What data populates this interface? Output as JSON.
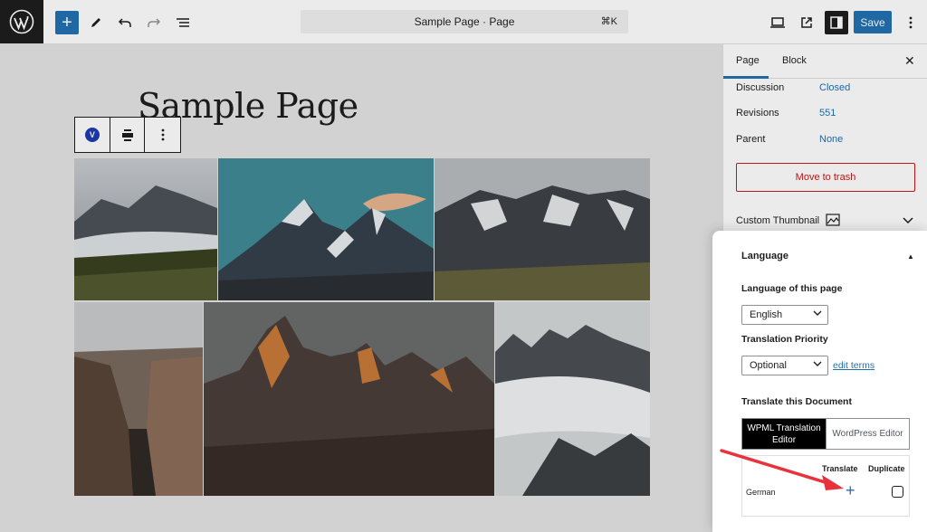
{
  "topbar": {
    "document_title": "Sample Page · Page",
    "shortcut": "⌘K",
    "save_label": "Save",
    "icons": [
      "wordpress-icon",
      "plus-icon",
      "pencil-icon",
      "undo-icon",
      "redo-icon",
      "list-view-icon",
      "desktop-icon",
      "external-link-icon",
      "sidebar-icon",
      "kebab-icon"
    ]
  },
  "editor": {
    "page_title": "Sample Page",
    "block_toolbar": {
      "badge": "V"
    }
  },
  "sidebar": {
    "tabs": [
      {
        "label": "Page"
      },
      {
        "label": "Block"
      }
    ],
    "properties": [
      {
        "label": "Discussion",
        "value": "Closed"
      },
      {
        "label": "Revisions",
        "value": "551"
      },
      {
        "label": "Parent",
        "value": "None"
      }
    ],
    "trash_label": "Move to trash",
    "custom_thumbnail_label": "Custom Thumbnail"
  },
  "language_panel": {
    "title": "Language",
    "language_label": "Language of this page",
    "language_value": "English",
    "priority_label": "Translation Priority",
    "priority_value": "Optional",
    "edit_terms": "edit terms",
    "translate_doc_label": "Translate this Document",
    "editor_tabs": [
      {
        "label": "WPML Translation Editor",
        "active": true
      },
      {
        "label": "WordPress Editor",
        "active": false
      }
    ],
    "table": {
      "col_translate": "Translate",
      "col_duplicate": "Duplicate",
      "rows": [
        {
          "language": "German"
        }
      ]
    }
  },
  "colors": {
    "accent": "#2271b1",
    "danger": "#cc1818",
    "annotation_arrow": "#e8323c"
  }
}
